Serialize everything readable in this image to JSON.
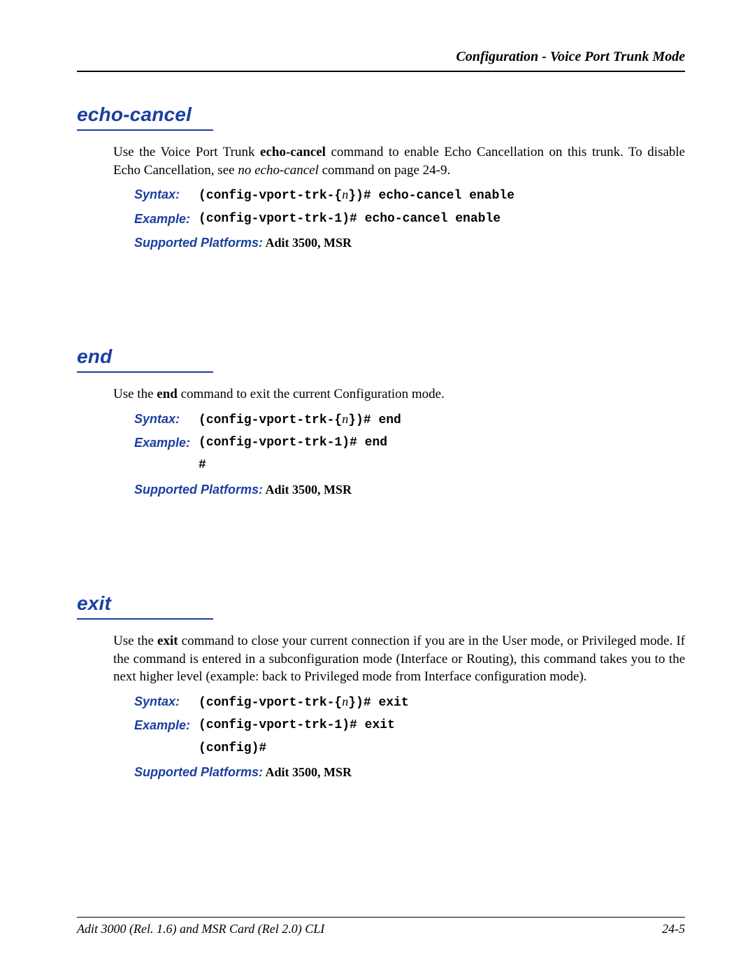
{
  "header": {
    "title": "Configuration - Voice Port Trunk Mode"
  },
  "sections": [
    {
      "title": "echo-cancel",
      "body_pre": "Use the Voice Port Trunk ",
      "body_bold": "echo-cancel",
      "body_mid": " command to enable Echo Cancellation on this trunk. To disable Echo Cancellation, see ",
      "body_ital": "no echo-cancel",
      "body_post": " command on page 24-9.",
      "syntax_label": "Syntax:",
      "syntax_pre": "(config-vport-trk-{",
      "syntax_var": "n",
      "syntax_post": "})# echo-cancel enable",
      "example_label": "Example:",
      "example_lines": [
        "(config-vport-trk-1)# echo-cancel enable"
      ],
      "platforms_label": "Supported Platforms:",
      "platforms_value": "  Adit 3500, MSR"
    },
    {
      "title": "end",
      "body_pre": "Use the ",
      "body_bold": "end",
      "body_mid": " command to exit the current Configuration mode.",
      "body_ital": "",
      "body_post": "",
      "syntax_label": "Syntax:",
      "syntax_pre": "(config-vport-trk-{",
      "syntax_var": "n",
      "syntax_post": "})# end",
      "example_label": "Example:",
      "example_lines": [
        "(config-vport-trk-1)# end",
        "#"
      ],
      "platforms_label": "Supported Platforms:",
      "platforms_value": "  Adit 3500, MSR"
    },
    {
      "title": "exit",
      "body_pre": "Use the ",
      "body_bold": "exit",
      "body_mid": " command to close your current connection if you are in the User mode, or Privileged mode. If the command is entered in a subconfiguration mode (Interface or Routing), this command takes you to the next higher level (example: back to Privileged mode from Interface configuration mode).",
      "body_ital": "",
      "body_post": "",
      "syntax_label": "Syntax:",
      "syntax_pre": "(config-vport-trk-{",
      "syntax_var": "n",
      "syntax_post": "})# exit",
      "example_label": "Example:",
      "example_lines": [
        "(config-vport-trk-1)# exit",
        "(config)#"
      ],
      "platforms_label": "Supported Platforms:",
      "platforms_value": "  Adit 3500, MSR"
    }
  ],
  "footer": {
    "left": "Adit 3000 (Rel. 1.6) and MSR Card (Rel 2.0) CLI",
    "right": "24-5"
  }
}
